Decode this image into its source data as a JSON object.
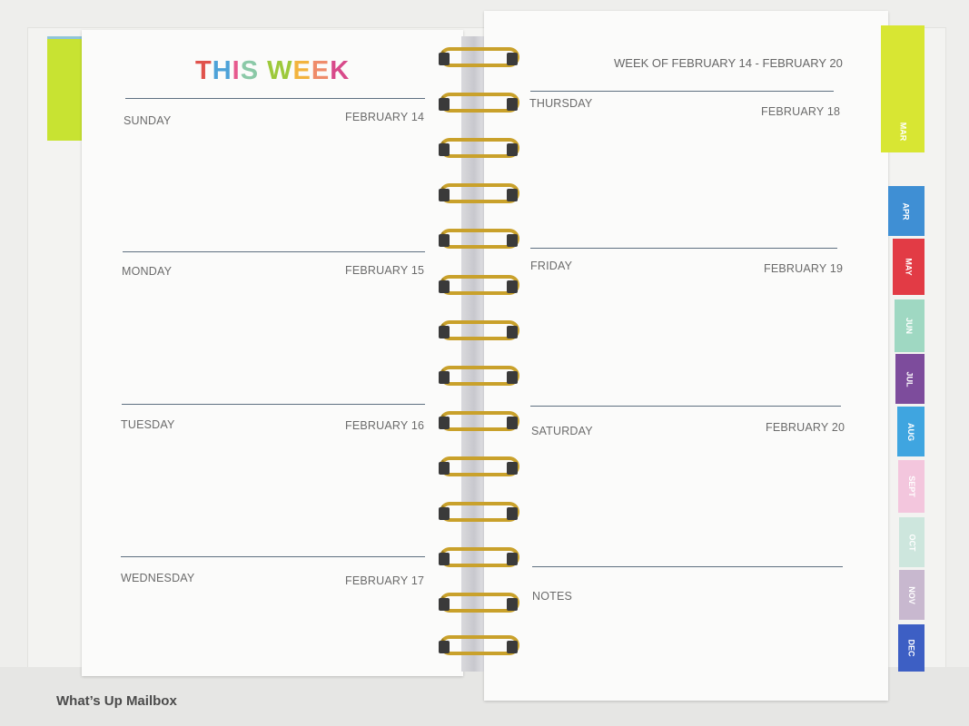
{
  "left_page": {
    "title_letters": [
      {
        "ch": "T",
        "color": "#e0524b"
      },
      {
        "ch": "H",
        "color": "#4ea2d8"
      },
      {
        "ch": "I",
        "color": "#e65a8e"
      },
      {
        "ch": "S",
        "color": "#8bc9a7"
      },
      {
        "ch": " ",
        "color": "#000000"
      },
      {
        "ch": "W",
        "color": "#9dc93b"
      },
      {
        "ch": "E",
        "color": "#f2b33d"
      },
      {
        "ch": "E",
        "color": "#ef8b6a"
      },
      {
        "ch": "K",
        "color": "#d84a8a"
      }
    ],
    "days": [
      {
        "name": "SUNDAY",
        "date": "FEBRUARY 14"
      },
      {
        "name": "MONDAY",
        "date": "FEBRUARY 15"
      },
      {
        "name": "TUESDAY",
        "date": "FEBRUARY 16"
      },
      {
        "name": "WEDNESDAY",
        "date": "FEBRUARY 17"
      }
    ]
  },
  "right_page": {
    "week_of": "WEEK OF FEBRUARY 14 - FEBRUARY 20",
    "days": [
      {
        "name": "THURSDAY",
        "date": "FEBRUARY 18"
      },
      {
        "name": "FRIDAY",
        "date": "FEBRUARY 19"
      },
      {
        "name": "SATURDAY",
        "date": "FEBRUARY 20"
      }
    ],
    "notes_label": "NOTES"
  },
  "month_tabs": [
    {
      "label": "MAR",
      "color": "#d8e633"
    },
    {
      "label": "APR",
      "color": "#3f8fd4"
    },
    {
      "label": "MAY",
      "color": "#e23b45"
    },
    {
      "label": "JUN",
      "color": "#9fd8c2"
    },
    {
      "label": "JUL",
      "color": "#7d4c9c"
    },
    {
      "label": "AUG",
      "color": "#3fa5e0"
    },
    {
      "label": "SEPT",
      "color": "#f3c6dd"
    },
    {
      "label": "OCT",
      "color": "#cde6dd"
    },
    {
      "label": "NOV",
      "color": "#c8b8cf"
    },
    {
      "label": "DEC",
      "color": "#3d5fc4"
    }
  ],
  "watermark": "What’s Up Mailbox"
}
